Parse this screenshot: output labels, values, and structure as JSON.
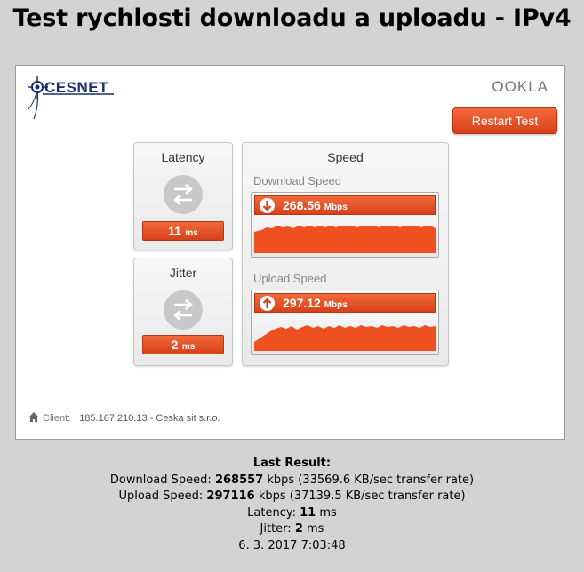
{
  "page": {
    "title": "Test rychlosti downloadu a uploadu - IPv4"
  },
  "widget": {
    "logo_text": "CESNET",
    "ookla_text": "OOKLA",
    "restart_label": "Restart Test",
    "latency": {
      "title": "Latency",
      "value": "11",
      "unit": "ms"
    },
    "jitter": {
      "title": "Jitter",
      "value": "2",
      "unit": "ms"
    },
    "speed": {
      "title": "Speed",
      "download": {
        "title": "Download Speed",
        "value": "268.56",
        "unit": "Mbps"
      },
      "upload": {
        "title": "Upload Speed",
        "value": "297.12",
        "unit": "Mbps"
      }
    },
    "client": {
      "label": "Client:",
      "value": "185.167.210.13 - Ceska sit s.r.o."
    }
  },
  "results": {
    "heading": "Last Result:",
    "download_label": "Download Speed:",
    "download_value": "268557",
    "download_rest": "kbps (33569.6 KB/sec transfer rate)",
    "upload_label": "Upload Speed:",
    "upload_value": "297116",
    "upload_rest": "kbps (37139.5 KB/sec transfer rate)",
    "latency_label": "Latency:",
    "latency_value": "11",
    "latency_unit": "ms",
    "jitter_label": "Jitter:",
    "jitter_value": "2",
    "jitter_unit": "ms",
    "timestamp": "6. 3. 2017 7:03:48"
  },
  "colors": {
    "accent": "#e2501f",
    "background": "#d3d3d3"
  }
}
